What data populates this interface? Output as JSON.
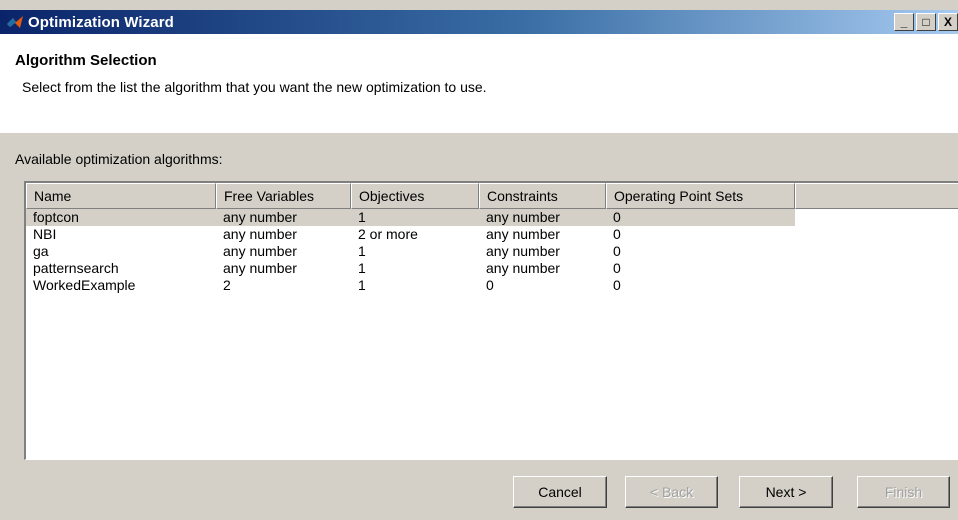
{
  "window": {
    "title": "Optimization Wizard",
    "controls": {
      "minimize": "_",
      "maximize": "□",
      "close": "X"
    }
  },
  "header": {
    "title": "Algorithm Selection",
    "description": "Select from the list the algorithm that you want the new optimization to use."
  },
  "list_label": "Available optimization algorithms:",
  "table": {
    "columns": [
      "Name",
      "Free Variables",
      "Objectives",
      "Constraints",
      "Operating Point Sets"
    ],
    "rows": [
      [
        "foptcon",
        "any number",
        "1",
        "any number",
        "0"
      ],
      [
        "NBI",
        "any number",
        "2 or more",
        "any number",
        "0"
      ],
      [
        "ga",
        "any number",
        "1",
        "any number",
        "0"
      ],
      [
        "patternsearch",
        "any number",
        "1",
        "any number",
        "0"
      ],
      [
        "WorkedExample",
        "2",
        "1",
        "0",
        "0"
      ]
    ],
    "selected_row": "foptcon"
  },
  "buttons": {
    "cancel": "Cancel",
    "back": "< Back",
    "next": "Next >",
    "finish": "Finish"
  },
  "colors": {
    "title_gradient_start": "#0a246a",
    "title_gradient_end": "#a6caf0",
    "dialog_bg": "#d4d0c8",
    "panel_bg": "#ffffff"
  },
  "icons": {
    "app": "matlab-logo-icon"
  }
}
